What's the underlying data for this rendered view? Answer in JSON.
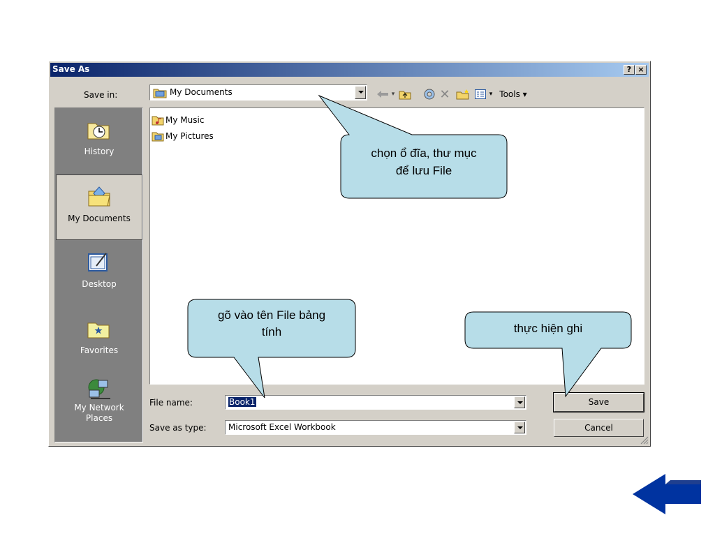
{
  "dialog": {
    "title": "Save As",
    "help_label": "?",
    "close_label": "×"
  },
  "toolbar": {
    "save_in_label": "Save in:",
    "save_in_value": "My Documents",
    "tools_label": "Tools ▾"
  },
  "places": [
    {
      "label": "History",
      "icon": "history-icon"
    },
    {
      "label": "My Documents",
      "icon": "my-documents-icon"
    },
    {
      "label": "Desktop",
      "icon": "desktop-icon"
    },
    {
      "label": "Favorites",
      "icon": "favorites-icon"
    },
    {
      "label": "My Network Places",
      "icon": "network-icon"
    }
  ],
  "files": [
    "My Music",
    "My Pictures"
  ],
  "form": {
    "file_name_label": "File name:",
    "file_name_value": "Book1",
    "save_type_label": "Save as type:",
    "save_type_value": "Microsoft Excel Workbook",
    "save_button": "Save",
    "cancel_button": "Cancel"
  },
  "callouts": {
    "folder_line1": "chọn ổ đĩa, thư mục",
    "folder_line2": "để lưu File",
    "filename_line1": "gõ vào tên File bảng",
    "filename_line2": "tính",
    "save_line1": "thực hiện ghi"
  },
  "colors": {
    "callout_fill": "#b7dde8",
    "title_gradient_start": "#0a246a",
    "back_arrow": "#0033a0"
  }
}
